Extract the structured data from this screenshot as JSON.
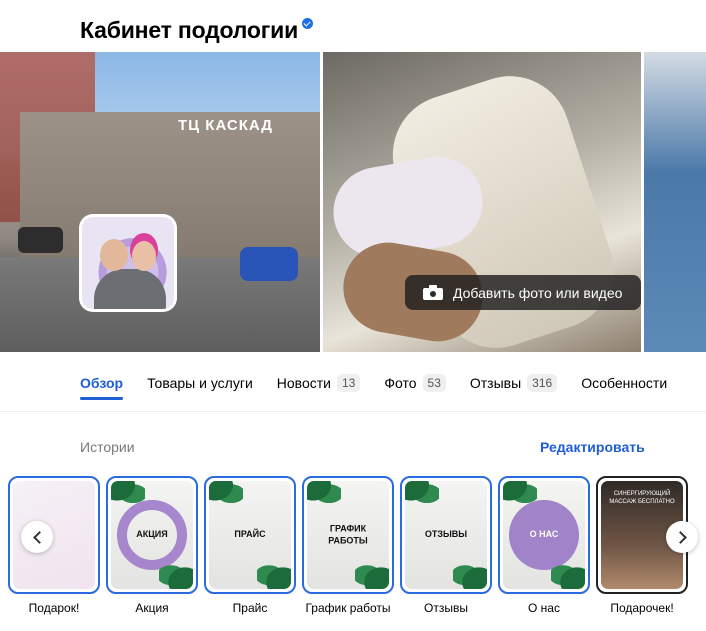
{
  "header": {
    "title": "Кабинет подологии"
  },
  "gallery": {
    "building_sign": "ТЦ КАСКАД",
    "add_media_label": "Добавить фото или видео"
  },
  "tabs": [
    {
      "label": "Обзор",
      "count": null,
      "active": true
    },
    {
      "label": "Товары и услуги",
      "count": null
    },
    {
      "label": "Новости",
      "count": "13"
    },
    {
      "label": "Фото",
      "count": "53"
    },
    {
      "label": "Отзывы",
      "count": "316"
    },
    {
      "label": "Особенности",
      "count": null
    }
  ],
  "stories": {
    "label": "Истории",
    "edit_label": "Редактировать",
    "items": [
      {
        "caption": "Подарок!"
      },
      {
        "caption": "Акция",
        "card_text": "АКЦИЯ"
      },
      {
        "caption": "Прайс",
        "card_text": "ПРАЙС"
      },
      {
        "caption": "График работы",
        "card_text": "ГРАФИК РАБОТЫ"
      },
      {
        "caption": "Отзывы",
        "card_text": "ОТЗЫВЫ"
      },
      {
        "caption": "О нас",
        "card_text": "О НАС"
      },
      {
        "caption": "Подарочек!",
        "card_text": "СИНЕРГИРУЮЩИЙ МАССАЖ БЕСПЛАТНО"
      }
    ]
  },
  "colors": {
    "accent": "#1f5fd6",
    "story_ring": "#a686cc",
    "story_border": "#2a6be0"
  }
}
